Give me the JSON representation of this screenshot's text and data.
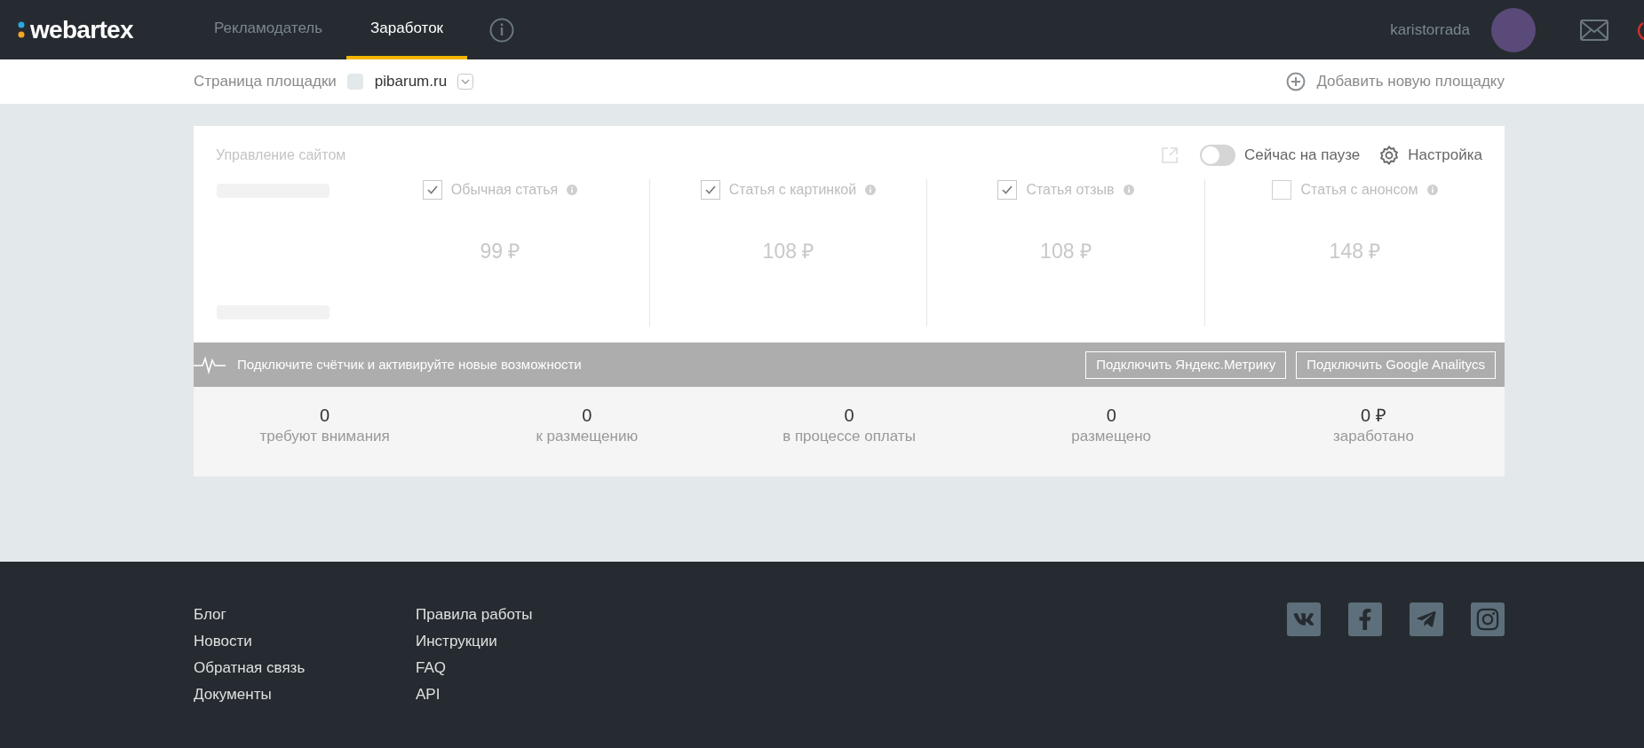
{
  "header": {
    "logo": "webartex",
    "tabs": [
      {
        "label": "Рекламодатель",
        "selected": false
      },
      {
        "label": "Заработок",
        "selected": true
      }
    ],
    "username": "karistorrada"
  },
  "site_bar": {
    "label": "Страница площадки",
    "site": "pibarum.ru",
    "add_link": "Добавить новую площадку"
  },
  "site_panel": {
    "title": "Управление сайтом",
    "pause_toggle": {
      "label": "Сейчас на паузе",
      "on": false
    },
    "settings": "Настройка",
    "article_types": [
      {
        "label": "Обычная статья",
        "checked": true,
        "price": "99 ₽"
      },
      {
        "label": "Статья с картинкой",
        "checked": true,
        "price": "108 ₽"
      },
      {
        "label": "Статья отзыв",
        "checked": true,
        "price": "108 ₽"
      },
      {
        "label": "Статья с анонсом",
        "checked": false,
        "price": "148 ₽"
      }
    ]
  },
  "counter_banner": {
    "text": "Подключите счётчик и активируйте новые возможности",
    "buttons": [
      "Подключить Яндекс.Метрику",
      "Подключить Google Analitycs"
    ]
  },
  "stats": [
    {
      "value": "0",
      "label": "требуют внимания"
    },
    {
      "value": "0",
      "label": "к размещению"
    },
    {
      "value": "0",
      "label": "в процессе оплаты"
    },
    {
      "value": "0",
      "label": "размещено"
    },
    {
      "value": "0 ₽",
      "label": "заработано"
    }
  ],
  "footer": {
    "columns": [
      [
        "Блог",
        "Новости",
        "Обратная связь",
        "Документы"
      ],
      [
        "Правила работы",
        "Инструкции",
        "FAQ",
        "API"
      ]
    ]
  }
}
